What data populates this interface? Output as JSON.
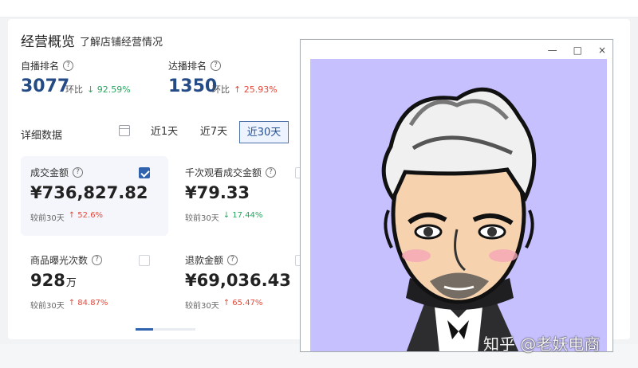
{
  "dashboard": {
    "title": "经营概览",
    "subtitle": "了解店铺经营情况",
    "self_rank": {
      "label": "自播排名",
      "value": "3077",
      "ratio_label": "环比",
      "change": "↓ 92.59%"
    },
    "reach_rank": {
      "label": "达播排名",
      "value": "1350",
      "ratio_label": "环比",
      "change": "↑ 25.93%"
    },
    "detail_label": "详细数据",
    "ranges": [
      "近1天",
      "近7天",
      "近30天"
    ],
    "active_range": "近30天",
    "cards": [
      {
        "title": "成交金额",
        "value": "¥736,827.82",
        "unit": "",
        "compare_label": "较前30天",
        "change": "↑ 52.6%",
        "checked": true
      },
      {
        "title": "千次观看成交金额",
        "value": "¥79.33",
        "unit": "",
        "compare_label": "较前30天",
        "change": "↓ 17.44%",
        "checked": false
      },
      {
        "title": "商品曝光次数",
        "value": "928",
        "unit": "万",
        "compare_label": "较前30天",
        "change": "↑ 84.87%",
        "checked": false
      },
      {
        "title": "退款金额",
        "value": "¥69,036.43",
        "unit": "",
        "compare_label": "较前30天",
        "change": "↑ 65.47%",
        "checked": false
      }
    ]
  },
  "window": {
    "controls": [
      "—",
      "□",
      "×"
    ]
  },
  "watermark": "知乎 @老妖电商",
  "colors": {
    "primary": "#244b86",
    "up": "#e24a3b",
    "down": "#27a55f",
    "avatar_background": "#c6c0ff"
  }
}
